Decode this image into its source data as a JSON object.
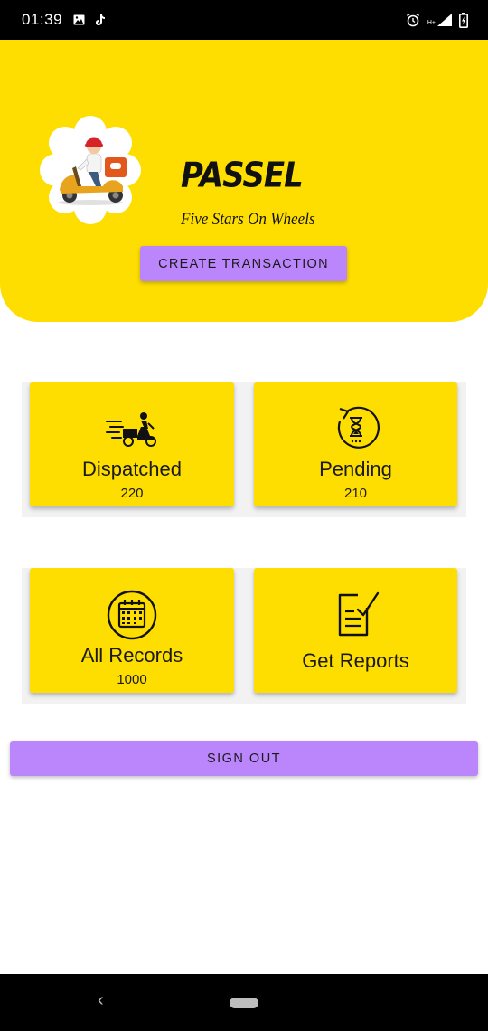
{
  "status_bar": {
    "time": "01:39",
    "icons": [
      "image-icon",
      "tiktok-icon",
      "alarm-icon",
      "network-icon",
      "signal-icon",
      "battery-icon"
    ],
    "network_label": "H+"
  },
  "header": {
    "background": "#FEDE00",
    "brand_title": "PASSEL",
    "tagline": "Five Stars On Wheels",
    "create_button_label": "CREATE TRANSACTION"
  },
  "cards": {
    "dispatched": {
      "label": "Dispatched",
      "count": "220",
      "icon": "delivery-scooter-icon"
    },
    "pending": {
      "label": "Pending",
      "count": "210",
      "icon": "hourglass-icon"
    },
    "all_records": {
      "label": "All Records",
      "count": "1000",
      "icon": "calendar-icon"
    },
    "get_reports": {
      "label": "Get Reports",
      "icon": "checklist-icon"
    }
  },
  "sign_out_label": "SIGN OUT",
  "colors": {
    "accent": "#BB86FC",
    "yellow": "#FEDE00"
  }
}
